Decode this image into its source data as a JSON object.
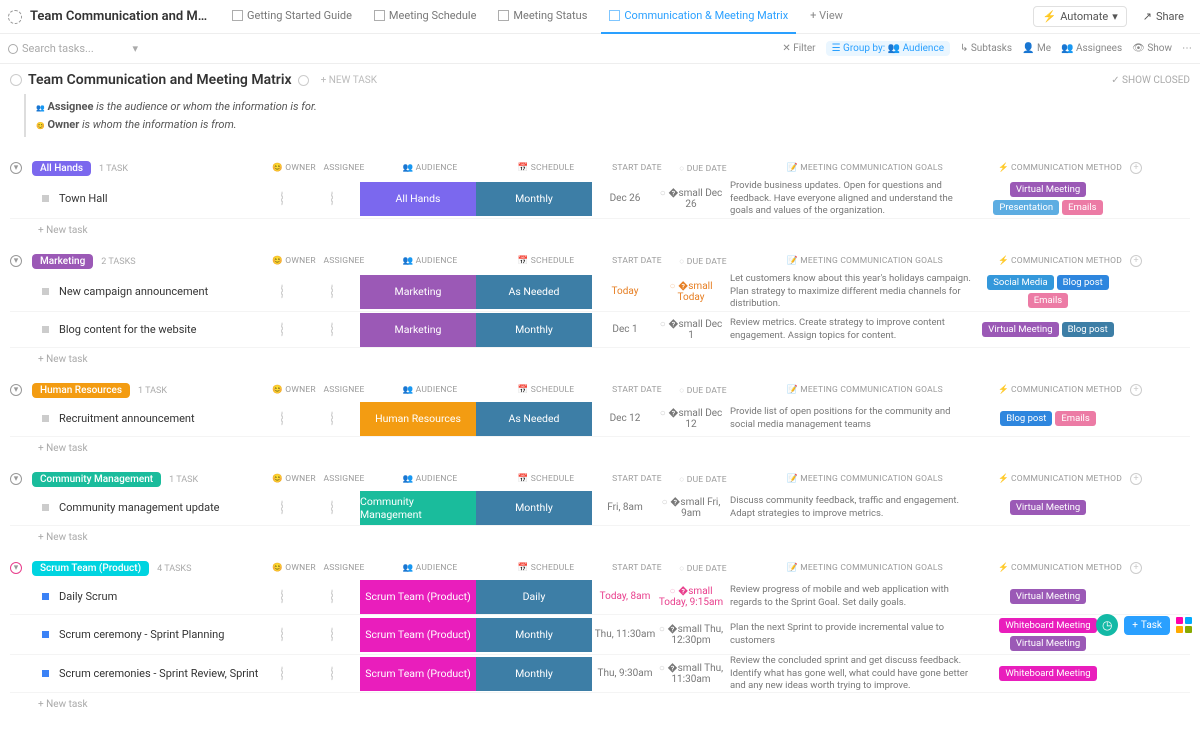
{
  "topbar": {
    "title": "Team Communication and Meeting Ma...",
    "tabs": [
      {
        "label": "Getting Started Guide",
        "active": false
      },
      {
        "label": "Meeting Schedule",
        "active": false
      },
      {
        "label": "Meeting Status",
        "active": false
      },
      {
        "label": "Communication & Meeting Matrix",
        "active": true
      },
      {
        "label": "+ View",
        "active": false,
        "add": true
      }
    ],
    "automate": "Automate",
    "share": "Share"
  },
  "filterbar": {
    "search_placeholder": "Search tasks...",
    "filter": "Filter",
    "groupby": "Group by:",
    "audience": "Audience",
    "subtasks": "Subtasks",
    "me": "Me",
    "assignees": "Assignees",
    "show": "Show"
  },
  "page": {
    "title": "Team Communication and Meeting Matrix",
    "newtask": "+ NEW TASK",
    "showclosed": "✓ SHOW CLOSED",
    "legend_assignee_label": "Assignee",
    "legend_assignee_text": " is the audience or whom the information is for.",
    "legend_owner_label": "Owner",
    "legend_owner_text": " is whom the information is from.",
    "newtask_row": "+ New task"
  },
  "columns": {
    "owner": "OWNER",
    "assignee": "ASSIGNEE",
    "audience": "AUDIENCE",
    "schedule": "SCHEDULE",
    "startdate": "START DATE",
    "duedate": "DUE DATE",
    "goals": "MEETING COMMUNICATION GOALS",
    "method": "COMMUNICATION METHOD"
  },
  "colors": {
    "allhands": "#7b68ee",
    "marketing": "#9b59b6",
    "hr": "#f39c12",
    "community": "#1abc9c",
    "scrum_label": "#00d4e0",
    "scrum": "#e91ebc",
    "schedule": "#3d7ea6",
    "virtual": "#9b59b6",
    "presentation": "#5dade2",
    "emails": "#ec7ba5",
    "social": "#3498db",
    "blogpost": "#2e86de",
    "blogpost2": "#3d7ea6",
    "whiteboard": "#e91ebc"
  },
  "groups": [
    {
      "key": "allhands",
      "label": "All Hands",
      "count": "1 TASK",
      "labelColor": "#7b68ee",
      "rows": [
        {
          "name": "Town Hall",
          "audience": "All Hands",
          "audColor": "#7b68ee",
          "schedule": "Monthly",
          "start": "Dec 26",
          "due": "Dec 26",
          "goals": "Provide business updates. Open for questions and feedback. Have everyone aligned and understand the goals and values of the organization.",
          "tags": [
            {
              "t": "Virtual Meeting",
              "c": "#9b59b6"
            },
            {
              "t": "Presentation",
              "c": "#5dade2"
            },
            {
              "t": "Emails",
              "c": "#ec7ba5"
            }
          ]
        }
      ]
    },
    {
      "key": "marketing",
      "label": "Marketing",
      "count": "2 TASKS",
      "labelColor": "#9b59b6",
      "rows": [
        {
          "name": "New campaign announcement",
          "audience": "Marketing",
          "audColor": "#9b59b6",
          "schedule": "As Needed",
          "start": "Today",
          "startClass": "today",
          "due": "Today",
          "dueClass": "today",
          "goals": "Let customers know about this year's holidays campaign. Plan strategy to maximize different media channels for distribution.",
          "tags": [
            {
              "t": "Social Media",
              "c": "#3498db"
            },
            {
              "t": "Blog post",
              "c": "#2e86de"
            },
            {
              "t": "Emails",
              "c": "#ec7ba5"
            }
          ]
        },
        {
          "name": "Blog content for the website",
          "audience": "Marketing",
          "audColor": "#9b59b6",
          "schedule": "Monthly",
          "start": "Dec 1",
          "due": "Dec 1",
          "goals": "Review metrics. Create strategy to improve content engagement. Assign topics for content.",
          "tags": [
            {
              "t": "Virtual Meeting",
              "c": "#9b59b6"
            },
            {
              "t": "Blog post",
              "c": "#3d7ea6"
            }
          ]
        }
      ]
    },
    {
      "key": "hr",
      "label": "Human Resources",
      "count": "1 TASK",
      "labelColor": "#f39c12",
      "rows": [
        {
          "name": "Recruitment announcement",
          "audience": "Human Resources",
          "audColor": "#f39c12",
          "schedule": "As Needed",
          "start": "Dec 12",
          "due": "Dec 12",
          "goals": "Provide list of open positions for the community and social media management teams",
          "tags": [
            {
              "t": "Blog post",
              "c": "#2e86de"
            },
            {
              "t": "Emails",
              "c": "#ec7ba5"
            }
          ]
        }
      ]
    },
    {
      "key": "community",
      "label": "Community Management",
      "count": "1 TASK",
      "labelColor": "#1abc9c",
      "rows": [
        {
          "name": "Community management update",
          "audience": "Community Management",
          "audColor": "#1abc9c",
          "schedule": "Monthly",
          "start": "Fri, 8am",
          "due": "Fri, 9am",
          "goals": "Discuss community feedback, traffic and engagement. Adapt strategies to improve metrics.",
          "tags": [
            {
              "t": "Virtual Meeting",
              "c": "#9b59b6"
            }
          ]
        }
      ]
    },
    {
      "key": "scrum",
      "label": "Scrum Team (Product)",
      "count": "4 TASKS",
      "labelColor": "#00d4e0",
      "toggleClass": "pink",
      "rows": [
        {
          "name": "Daily Scrum",
          "dot": "blue",
          "audience": "Scrum Team (Product)",
          "audColor": "#e91ebc",
          "schedule": "Daily",
          "start": "Today, 8am",
          "startClass": "pink",
          "due": "Today, 9:15am",
          "dueClass": "pink",
          "goals": "Review progress of mobile and web application with regards to the Sprint Goal. Set daily goals.",
          "tags": [
            {
              "t": "Virtual Meeting",
              "c": "#9b59b6"
            }
          ]
        },
        {
          "name": "Scrum ceremony - Sprint Planning",
          "dot": "blue",
          "audience": "Scrum Team (Product)",
          "audColor": "#e91ebc",
          "schedule": "Monthly",
          "start": "Thu, 11:30am",
          "due": "Thu, 12:30pm",
          "goals": "Plan the next Sprint to provide incremental value to customers",
          "tags": [
            {
              "t": "Whiteboard Meeting",
              "c": "#e91ebc"
            },
            {
              "t": "Virtual Meeting",
              "c": "#9b59b6"
            }
          ]
        },
        {
          "name": "Scrum ceremonies - Sprint Review, Sprint",
          "dot": "blue",
          "audience": "Scrum Team (Product)",
          "audColor": "#e91ebc",
          "schedule": "Monthly",
          "start": "Thu, 9:30am",
          "due": "Thu, 11:30am",
          "goals": "Review the concluded sprint and get discuss feedback. Identify what has gone well, what could have gone better and any new ideas worth trying to improve.",
          "tags": [
            {
              "t": "Whiteboard Meeting",
              "c": "#e91ebc"
            }
          ]
        }
      ]
    }
  ],
  "float": {
    "task": "Task"
  }
}
